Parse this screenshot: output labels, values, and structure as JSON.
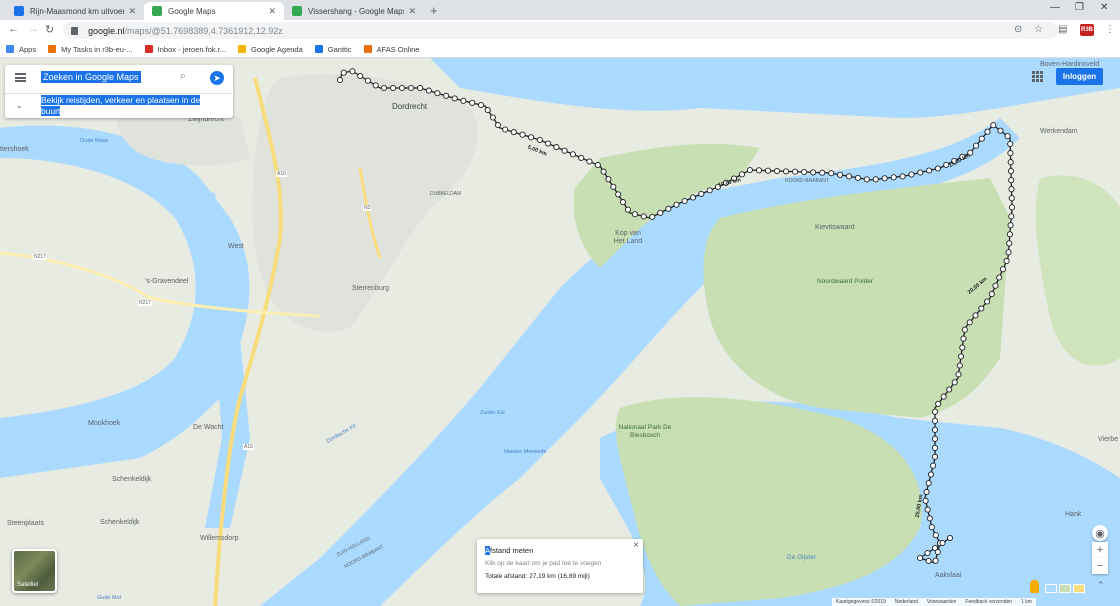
{
  "browser": {
    "tabs": [
      {
        "title": "Rijn-Maasmond km uitvoer (mc...",
        "favicon": "doc-icon",
        "color": "#1a73e8",
        "active": false
      },
      {
        "title": "Google Maps",
        "favicon": "maps-icon",
        "color": "#34a853",
        "active": true
      },
      {
        "title": "Vissershang - Google Maps",
        "favicon": "maps-icon",
        "color": "#34a853",
        "active": false
      }
    ],
    "new_tab": "+",
    "url_host": "google.nl",
    "url_path": "/maps/@51.7698389,4.7361912,12.92z",
    "profile": "R3B"
  },
  "bookmarks": [
    {
      "label": "Apps",
      "icon": "apps-icon",
      "color": "#4285f4"
    },
    {
      "label": "My Tasks in r3b-eu-...",
      "icon": "tasks-icon",
      "color": "#e8710a"
    },
    {
      "label": "Inbox - jeroen.fok.r...",
      "icon": "gmail-icon",
      "color": "#d93025"
    },
    {
      "label": "Google Agenda",
      "icon": "calendar-icon",
      "color": "#f4b400"
    },
    {
      "label": "Ganttic",
      "icon": "ganttic-icon",
      "color": "#1a73e8"
    },
    {
      "label": "AFAS Online",
      "icon": "afas-icon",
      "color": "#e8710a"
    }
  ],
  "search": {
    "placeholder": "Zoeken in Google Maps",
    "explore_text": "Bekijk reistijden, verkeer en plaatsen in de buurt"
  },
  "header": {
    "signin": "Inloggen"
  },
  "measure": {
    "title_first": "A",
    "title_rest": "fstand meten",
    "hint": "Klik op de kaart om je pad toe te voegen",
    "total": "Totale afstand: 27,19 km (16,89 mijl)"
  },
  "satellite_label": "Satelliet",
  "footer": {
    "copyright": "Kaartgegevens ©2019",
    "country": "Nederland",
    "terms": "Voorwaarden",
    "feedback": "Feedback verzenden",
    "scale": "1 km"
  },
  "map_labels": {
    "dordrecht": "Dordrecht",
    "zwijndrecht": "Zwijndrecht",
    "boven_hardinxveld": "Boven-Hardinxveld",
    "werkendam": "Werkendam",
    "kievitswaard": "Kievitswaard",
    "kop_van_het_land": "Kop van Het Land",
    "sterrenburg": "Sterrenburg",
    "west": "West",
    "dubbeldam": "DUBBELDAM",
    "gravendeel": "'s-Gravendeel",
    "noordwaard": "Noordwaard Polder",
    "nationaal_park": "Nationaal Park De Biesbosch",
    "mookhoek": "Mookhoek",
    "de_wacht": "De Wacht",
    "schenkeldijk1": "Schenkeldijk",
    "schenkeldijk2": "Schenkeldijk",
    "steenplaats": "Steenplaats",
    "willemsdorp": "Willemsdorp",
    "aakvlaai": "Aakvlaai",
    "hank": "Hank",
    "vierbe": "Vierbe",
    "ttershoek": "ttershoek",
    "zuid_holland": "ZUID-HOLLAND",
    "noord_brabant": "NOORD-BRABANT",
    "noord_brabant2": "NOORD-BRABANT",
    "a16_1": "A16",
    "a16_2": "A16",
    "n3": "N3",
    "n217_1": "N217",
    "n217_2": "N217",
    "de_gijster": "De Gijster",
    "nieuwe_merwede": "Nieuwe Merwede",
    "dordtsche_kil": "Dordtsche Kil",
    "oude_maas": "Oude Maas",
    "zuider_els": "Zuider Els",
    "gude_mol": "Gude Mol"
  },
  "distance_labels": {
    "d5": "5,00 km",
    "d10": "10,00 km",
    "d15": "15,00 km",
    "d20": "20,00 km",
    "d25": "25,00 km"
  },
  "colors": {
    "water": "#aadaff",
    "land": "#e8ebe2",
    "park": "#c8dfb3",
    "urban": "#dfe3dc",
    "highway": "#f9dc7b",
    "accent": "#1a73e8"
  }
}
